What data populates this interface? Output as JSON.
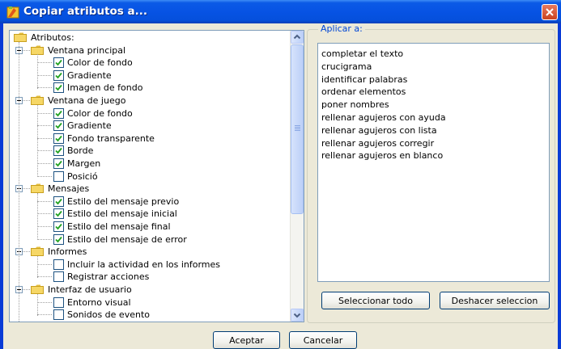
{
  "window": {
    "title": "Copiar atributos a..."
  },
  "tree": {
    "root": "Atributos:",
    "groups": [
      {
        "label": "Ventana principal",
        "items": [
          {
            "label": "Color de fondo",
            "checked": true
          },
          {
            "label": "Gradiente",
            "checked": true
          },
          {
            "label": "Imagen de fondo",
            "checked": true
          }
        ]
      },
      {
        "label": "Ventana de juego",
        "items": [
          {
            "label": "Color de fondo",
            "checked": true
          },
          {
            "label": "Gradiente",
            "checked": true
          },
          {
            "label": "Fondo transparente",
            "checked": true
          },
          {
            "label": "Borde",
            "checked": true
          },
          {
            "label": "Margen",
            "checked": true
          },
          {
            "label": "Posició",
            "checked": false
          }
        ]
      },
      {
        "label": "Mensajes",
        "items": [
          {
            "label": "Estilo del mensaje previo",
            "checked": true
          },
          {
            "label": "Estilo del mensaje inicial",
            "checked": true
          },
          {
            "label": "Estilo del mensaje final",
            "checked": true
          },
          {
            "label": "Estilo del mensaje de error",
            "checked": true
          }
        ]
      },
      {
        "label": "Informes",
        "items": [
          {
            "label": "Incluir la actividad en los informes",
            "checked": false
          },
          {
            "label": "Registrar acciones",
            "checked": false
          }
        ]
      },
      {
        "label": "Interfaz de usuario",
        "items": [
          {
            "label": "Entorno visual",
            "checked": false
          },
          {
            "label": "Sonidos de evento",
            "checked": false
          }
        ]
      }
    ]
  },
  "apply": {
    "label": "Aplicar a:",
    "items": [
      "completar el texto",
      "crucigrama",
      "identificar palabras",
      "ordenar elementos",
      "poner nombres",
      "rellenar agujeros con ayuda",
      "rellenar agujeros con lista",
      "rellenar agujeros corregir",
      "rellenar agujeros en blanco"
    ],
    "select_all": "Seleccionar todo",
    "deselect": "Deshacer seleccion"
  },
  "footer": {
    "ok": "Aceptar",
    "cancel": "Cancelar"
  },
  "colors": {
    "title_bar": "#0753e4",
    "dialog_bg": "#ece9d8",
    "group_label": "#0046d5",
    "check": "#21a121"
  }
}
